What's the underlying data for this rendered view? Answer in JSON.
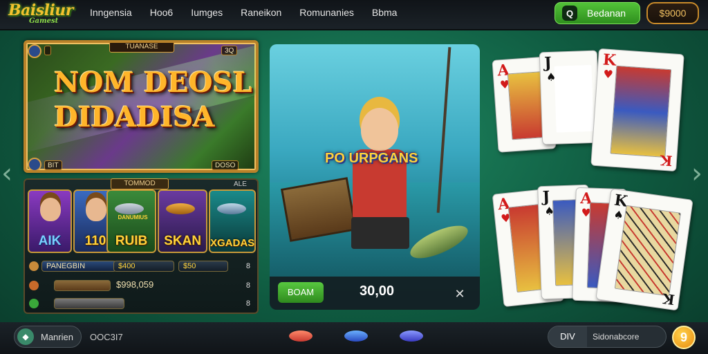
{
  "logo": {
    "main": "Baisliur",
    "sub": "Gamest"
  },
  "nav": [
    {
      "label": "Inngensia"
    },
    {
      "label": "Hoo6"
    },
    {
      "label": "Iumges"
    },
    {
      "label": "Raneikon"
    },
    {
      "label": "Romunanies"
    },
    {
      "label": "Bbma"
    }
  ],
  "header": {
    "action_icon": "Q",
    "action_label": "Bedanan",
    "balance": "$9000"
  },
  "banner": {
    "tag": "TUANASE",
    "title_line1": "NOM DEOSL",
    "title_line2": "DIDADISA",
    "top_right": "3Q",
    "bottom_left": "BIT",
    "bottom_right": "DOSO"
  },
  "panel": {
    "tag": "TOMMOD",
    "corner": "ALE",
    "tiles": [
      {
        "name": "AIK"
      },
      {
        "name": "110"
      },
      {
        "name": "RUIB",
        "subtitle": "DANUMIUS"
      },
      {
        "name": "SKAN"
      },
      {
        "name": "XGADAS"
      }
    ],
    "rows": [
      {
        "label": "PANEGBIN",
        "value": "$400",
        "extra": "$50",
        "count": "8"
      },
      {
        "label": "",
        "value": "$998,059",
        "extra": "",
        "count": "8"
      },
      {
        "label": "",
        "value": "",
        "extra": "",
        "count": "8"
      }
    ]
  },
  "feature": {
    "game_title": "PO URPGANS",
    "play_label": "BOAM",
    "amount": "30,00",
    "tool_icon": "✕"
  },
  "cards": [
    {
      "rank": "A",
      "suit": "♥",
      "color": "#d21a1a"
    },
    {
      "rank": "J",
      "suit": "♠",
      "color": "#111111"
    },
    {
      "rank": "K",
      "suit": "♥",
      "color": "#d21a1a"
    },
    {
      "rank": "A",
      "suit": "♥",
      "color": "#d21a1a"
    },
    {
      "rank": "J",
      "suit": "♠",
      "color": "#111111"
    },
    {
      "rank": "A",
      "suit": "♥",
      "color": "#d21a1a"
    },
    {
      "rank": "K",
      "suit": "♠",
      "color": "#111111"
    }
  ],
  "footer": {
    "home_icon": "◆",
    "home_label": "Manrien",
    "code": "OOC3I7",
    "div_label": "DIV",
    "right_label": "Sidonabcore",
    "coin_value": "9"
  },
  "colors": {
    "accent_green": "#52c238",
    "gold": "#ffd23a",
    "balance_border": "#c98b2a"
  }
}
